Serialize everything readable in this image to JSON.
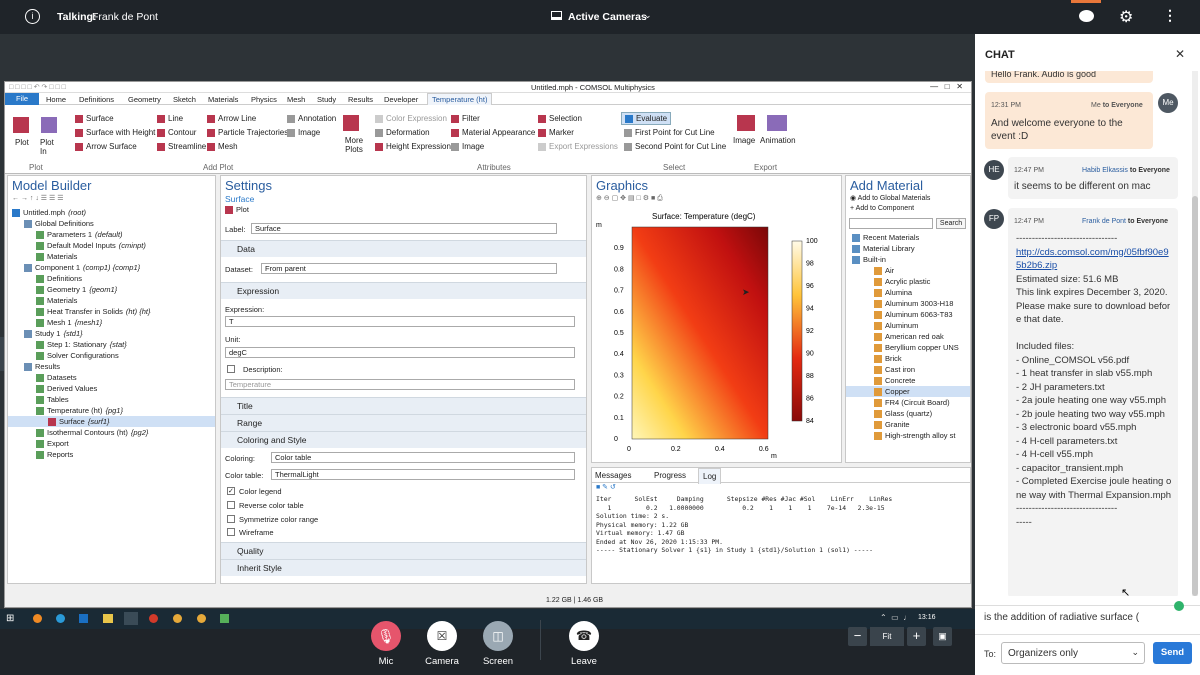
{
  "topbar": {
    "talking_prefix": "Talking:",
    "talking_name": "Frank de Pont",
    "view_label": "Active Cameras"
  },
  "comsol": {
    "window_title": "Untitled.mph - COMSOL Multiphysics",
    "menu": [
      "File",
      "Home",
      "Definitions",
      "Geometry",
      "Sketch",
      "Materials",
      "Physics",
      "Mesh",
      "Study",
      "Results",
      "Developer",
      "Temperature (ht)"
    ],
    "ribbon": {
      "plot": "Plot",
      "plot_in": "Plot In",
      "plot_group": "Plot",
      "surface": "Surface",
      "surface_height": "Surface with Height",
      "arrow_surface": "Arrow Surface",
      "line": "Line",
      "contour": "Contour",
      "streamline": "Streamline",
      "arrow_line": "Arrow Line",
      "particle_traj": "Particle Trajectories",
      "mesh": "Mesh",
      "annotation": "Annotation",
      "image": "Image",
      "more_plots": "More Plots",
      "add_plot_group": "Add Plot",
      "color_expr": "Color Expression",
      "deformation": "Deformation",
      "height_expr": "Height Expression",
      "filter": "Filter",
      "material_app": "Material Appearance",
      "image2": "Image",
      "selection": "Selection",
      "marker": "Marker",
      "export_expr": "Export Expressions",
      "attributes_group": "Attributes",
      "evaluate": "Evaluate",
      "first_point": "First Point for Cut Line",
      "second_point": "Second Point for Cut Line",
      "select_group": "Select",
      "image3": "Image",
      "animation": "Animation",
      "export_group": "Export"
    },
    "model_builder": {
      "title": "Model Builder",
      "items": [
        {
          "t": "Untitled.mph",
          "s": "(root)",
          "l": 0
        },
        {
          "t": "Global Definitions",
          "s": "",
          "l": 1
        },
        {
          "t": "Parameters 1",
          "s": "(default)",
          "l": 2
        },
        {
          "t": "Default Model Inputs",
          "s": "(cminpt)",
          "l": 2
        },
        {
          "t": "Materials",
          "s": "",
          "l": 2
        },
        {
          "t": "Component 1",
          "s": "(comp1) {comp1}",
          "l": 1
        },
        {
          "t": "Definitions",
          "s": "",
          "l": 2
        },
        {
          "t": "Geometry 1",
          "s": "{geom1}",
          "l": 2
        },
        {
          "t": "Materials",
          "s": "",
          "l": 2
        },
        {
          "t": "Heat Transfer in Solids",
          "s": "(ht) {ht}",
          "l": 2
        },
        {
          "t": "Mesh 1",
          "s": "{mesh1}",
          "l": 2
        },
        {
          "t": "Study 1",
          "s": "{std1}",
          "l": 1
        },
        {
          "t": "Step 1: Stationary",
          "s": "{stat}",
          "l": 2
        },
        {
          "t": "Solver Configurations",
          "s": "",
          "l": 2
        },
        {
          "t": "Results",
          "s": "",
          "l": 1
        },
        {
          "t": "Datasets",
          "s": "",
          "l": 2
        },
        {
          "t": "Derived Values",
          "s": "",
          "l": 2
        },
        {
          "t": "Tables",
          "s": "",
          "l": 2
        },
        {
          "t": "Temperature (ht)",
          "s": "{pg1}",
          "l": 2
        },
        {
          "t": "Surface",
          "s": "{surf1}",
          "l": 3
        },
        {
          "t": "Isothermal Contours (ht)",
          "s": "{pg2}",
          "l": 2
        },
        {
          "t": "Export",
          "s": "",
          "l": 2
        },
        {
          "t": "Reports",
          "s": "",
          "l": 2
        }
      ]
    },
    "settings": {
      "title": "Settings",
      "subtitle": "Surface",
      "plot_btn": "Plot",
      "label_lbl": "Label:",
      "label_val": "Surface",
      "data_sec": "Data",
      "dataset_lbl": "Dataset:",
      "dataset_val": "From parent",
      "expr_sec": "Expression",
      "expr_lbl": "Expression:",
      "expr_val": "T",
      "unit_lbl": "Unit:",
      "unit_val": "degC",
      "desc_lbl": "Description:",
      "desc_val": "Temperature",
      "title_sec": "Title",
      "range_sec": "Range",
      "color_sec": "Coloring and Style",
      "coloring_lbl": "Coloring:",
      "coloring_val": "Color table",
      "ctable_lbl": "Color table:",
      "ctable_val": "ThermalLight",
      "cb_legend": "Color legend",
      "cb_reverse": "Reverse color table",
      "cb_sym": "Symmetrize color range",
      "cb_wire": "Wireframe",
      "quality_sec": "Quality",
      "inherit_sec": "Inherit Style"
    },
    "graphics": {
      "title": "Graphics",
      "plot_title": "Surface: Temperature (degC)",
      "y_unit": "m",
      "x_unit": "m"
    },
    "add_material": {
      "title": "Add Material",
      "add_global": "Add to Global Materials",
      "add_comp": "Add to Component",
      "search": "Search",
      "items": [
        "Recent Materials",
        "Material Library",
        "Built-in",
        "Air",
        "Acrylic plastic",
        "Alumina",
        "Aluminum 3003-H18",
        "Aluminum 6063-T83",
        "Aluminum",
        "American red oak",
        "Beryllium copper UNS",
        "Brick",
        "Cast iron",
        "Concrete",
        "Copper",
        "FR4 (Circuit Board)",
        "Glass (quartz)",
        "Granite",
        "High-strength alloy st"
      ]
    },
    "messages": {
      "tabs": [
        "Messages",
        "Progress",
        "Log"
      ],
      "lines": [
        "Iter      SolEst     Damping      Stepsize #Res #Jac #Sol    LinErr    LinRes",
        "   1         0.2   1.0000000          0.2    1    1    1    7e-14   2.3e-15",
        "Solution time: 2 s.",
        "Physical memory: 1.22 GB",
        "Virtual memory: 1.47 GB",
        "Ended at Nov 26, 2020 1:15:33 PM.",
        "----- Stationary Solver 1 {s1} in Study 1 {std1}/Solution 1 (sol1) -----"
      ]
    },
    "status_memory": "1.22 GB | 1.46 GB"
  },
  "chart_data": {
    "type": "heatmap",
    "title": "Surface: Temperature (degC)",
    "xlabel": "m",
    "ylabel": "m",
    "x_ticks": [
      0,
      0.2,
      0.4,
      0.6
    ],
    "y_ticks": [
      0,
      0.1,
      0.2,
      0.3,
      0.4,
      0.5,
      0.6,
      0.7,
      0.8,
      0.9
    ],
    "xlim": [
      0,
      0.6
    ],
    "ylim": [
      0,
      1
    ],
    "colorbar": {
      "min": 84,
      "max": 100,
      "ticks": [
        84,
        86,
        88,
        90,
        92,
        94,
        96,
        98,
        100
      ],
      "colormap": "ThermalLight"
    }
  },
  "taskbar": {
    "time": "13:16"
  },
  "chat": {
    "title": "CHAT",
    "msg0": "Hello Frank. Audio is good",
    "m1": {
      "time": "12:31 PM",
      "from": "Me",
      "to": "to Everyone",
      "text": "And welcome everyone to the event :D",
      "avatar": "Me"
    },
    "m2": {
      "time": "12:47 PM",
      "from": "Habib Elkassis",
      "to": "to Everyone",
      "text": "it seems to be different on mac",
      "avatar": "HE"
    },
    "m3": {
      "time": "12:47 PM",
      "from": "Frank de Pont",
      "to": "to Everyone",
      "avatar": "FP",
      "lines": [
        "--------------------------------",
        "http://cds.comsol.com/mg/05fbf90e95b2b6.zip",
        "Estimated size: 51.6 MB",
        "This link expires December 3, 2020.",
        "Please make sure to download before that date.",
        "",
        "Included files:",
        "- Online_COMSOL v56.pdf",
        "- 1 heat transfer in slab v55.mph",
        "- 2 JH parameters.txt",
        "- 2a joule heating one way v55.mph",
        "- 2b joule heating two way v55.mph",
        "- 3 electronic board v55.mph",
        "- 4 H-cell parameters.txt",
        "- 4 H-cell v55.mph",
        "- capacitor_transient.mph",
        "- Completed Exercise joule heating one way with Thermal Expansion.mph",
        "--------------------------------",
        "-----"
      ]
    },
    "input_value": "is the addition of radiative surface (",
    "to_label": "To:",
    "to_value": "Organizers only",
    "send": "Send"
  },
  "controls": {
    "mic": "Mic",
    "camera": "Camera",
    "screen": "Screen",
    "leave": "Leave",
    "fit": "Fit"
  }
}
